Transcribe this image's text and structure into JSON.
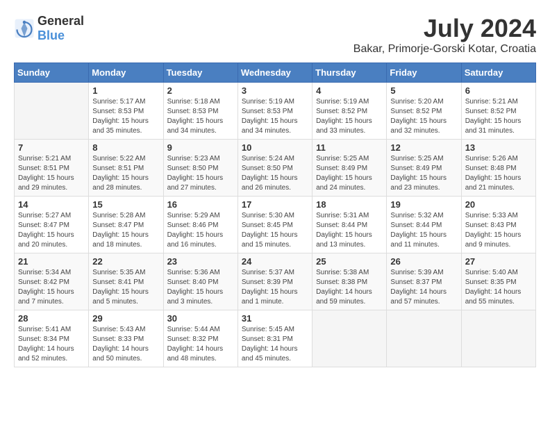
{
  "logo": {
    "general": "General",
    "blue": "Blue"
  },
  "title": {
    "month": "July 2024",
    "location": "Bakar, Primorje-Gorski Kotar, Croatia"
  },
  "headers": [
    "Sunday",
    "Monday",
    "Tuesday",
    "Wednesday",
    "Thursday",
    "Friday",
    "Saturday"
  ],
  "weeks": [
    [
      {
        "day": "",
        "info": ""
      },
      {
        "day": "1",
        "info": "Sunrise: 5:17 AM\nSunset: 8:53 PM\nDaylight: 15 hours\nand 35 minutes."
      },
      {
        "day": "2",
        "info": "Sunrise: 5:18 AM\nSunset: 8:53 PM\nDaylight: 15 hours\nand 34 minutes."
      },
      {
        "day": "3",
        "info": "Sunrise: 5:19 AM\nSunset: 8:53 PM\nDaylight: 15 hours\nand 34 minutes."
      },
      {
        "day": "4",
        "info": "Sunrise: 5:19 AM\nSunset: 8:52 PM\nDaylight: 15 hours\nand 33 minutes."
      },
      {
        "day": "5",
        "info": "Sunrise: 5:20 AM\nSunset: 8:52 PM\nDaylight: 15 hours\nand 32 minutes."
      },
      {
        "day": "6",
        "info": "Sunrise: 5:21 AM\nSunset: 8:52 PM\nDaylight: 15 hours\nand 31 minutes."
      }
    ],
    [
      {
        "day": "7",
        "info": "Sunrise: 5:21 AM\nSunset: 8:51 PM\nDaylight: 15 hours\nand 29 minutes."
      },
      {
        "day": "8",
        "info": "Sunrise: 5:22 AM\nSunset: 8:51 PM\nDaylight: 15 hours\nand 28 minutes."
      },
      {
        "day": "9",
        "info": "Sunrise: 5:23 AM\nSunset: 8:50 PM\nDaylight: 15 hours\nand 27 minutes."
      },
      {
        "day": "10",
        "info": "Sunrise: 5:24 AM\nSunset: 8:50 PM\nDaylight: 15 hours\nand 26 minutes."
      },
      {
        "day": "11",
        "info": "Sunrise: 5:25 AM\nSunset: 8:49 PM\nDaylight: 15 hours\nand 24 minutes."
      },
      {
        "day": "12",
        "info": "Sunrise: 5:25 AM\nSunset: 8:49 PM\nDaylight: 15 hours\nand 23 minutes."
      },
      {
        "day": "13",
        "info": "Sunrise: 5:26 AM\nSunset: 8:48 PM\nDaylight: 15 hours\nand 21 minutes."
      }
    ],
    [
      {
        "day": "14",
        "info": "Sunrise: 5:27 AM\nSunset: 8:47 PM\nDaylight: 15 hours\nand 20 minutes."
      },
      {
        "day": "15",
        "info": "Sunrise: 5:28 AM\nSunset: 8:47 PM\nDaylight: 15 hours\nand 18 minutes."
      },
      {
        "day": "16",
        "info": "Sunrise: 5:29 AM\nSunset: 8:46 PM\nDaylight: 15 hours\nand 16 minutes."
      },
      {
        "day": "17",
        "info": "Sunrise: 5:30 AM\nSunset: 8:45 PM\nDaylight: 15 hours\nand 15 minutes."
      },
      {
        "day": "18",
        "info": "Sunrise: 5:31 AM\nSunset: 8:44 PM\nDaylight: 15 hours\nand 13 minutes."
      },
      {
        "day": "19",
        "info": "Sunrise: 5:32 AM\nSunset: 8:44 PM\nDaylight: 15 hours\nand 11 minutes."
      },
      {
        "day": "20",
        "info": "Sunrise: 5:33 AM\nSunset: 8:43 PM\nDaylight: 15 hours\nand 9 minutes."
      }
    ],
    [
      {
        "day": "21",
        "info": "Sunrise: 5:34 AM\nSunset: 8:42 PM\nDaylight: 15 hours\nand 7 minutes."
      },
      {
        "day": "22",
        "info": "Sunrise: 5:35 AM\nSunset: 8:41 PM\nDaylight: 15 hours\nand 5 minutes."
      },
      {
        "day": "23",
        "info": "Sunrise: 5:36 AM\nSunset: 8:40 PM\nDaylight: 15 hours\nand 3 minutes."
      },
      {
        "day": "24",
        "info": "Sunrise: 5:37 AM\nSunset: 8:39 PM\nDaylight: 15 hours\nand 1 minute."
      },
      {
        "day": "25",
        "info": "Sunrise: 5:38 AM\nSunset: 8:38 PM\nDaylight: 14 hours\nand 59 minutes."
      },
      {
        "day": "26",
        "info": "Sunrise: 5:39 AM\nSunset: 8:37 PM\nDaylight: 14 hours\nand 57 minutes."
      },
      {
        "day": "27",
        "info": "Sunrise: 5:40 AM\nSunset: 8:35 PM\nDaylight: 14 hours\nand 55 minutes."
      }
    ],
    [
      {
        "day": "28",
        "info": "Sunrise: 5:41 AM\nSunset: 8:34 PM\nDaylight: 14 hours\nand 52 minutes."
      },
      {
        "day": "29",
        "info": "Sunrise: 5:43 AM\nSunset: 8:33 PM\nDaylight: 14 hours\nand 50 minutes."
      },
      {
        "day": "30",
        "info": "Sunrise: 5:44 AM\nSunset: 8:32 PM\nDaylight: 14 hours\nand 48 minutes."
      },
      {
        "day": "31",
        "info": "Sunrise: 5:45 AM\nSunset: 8:31 PM\nDaylight: 14 hours\nand 45 minutes."
      },
      {
        "day": "",
        "info": ""
      },
      {
        "day": "",
        "info": ""
      },
      {
        "day": "",
        "info": ""
      }
    ]
  ]
}
